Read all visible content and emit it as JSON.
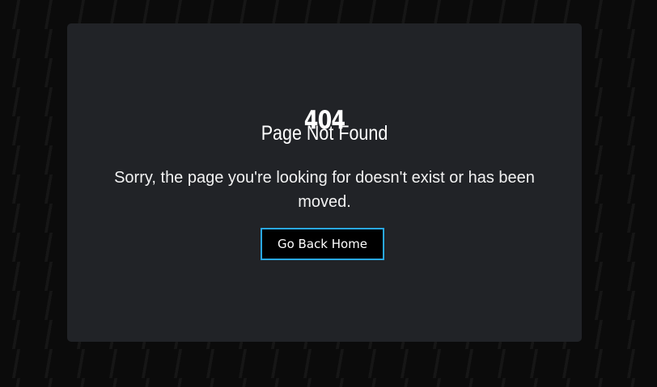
{
  "error": {
    "code": "404",
    "title": "Page Not Found",
    "message": "Sorry, the page you're looking for doesn't exist or has been moved.",
    "button_label": "Go Back Home"
  },
  "colors": {
    "background": "#0b0b0b",
    "card": "#212327",
    "text": "#ffffff",
    "button_border": "#29a8e8",
    "button_background": "#000000"
  }
}
